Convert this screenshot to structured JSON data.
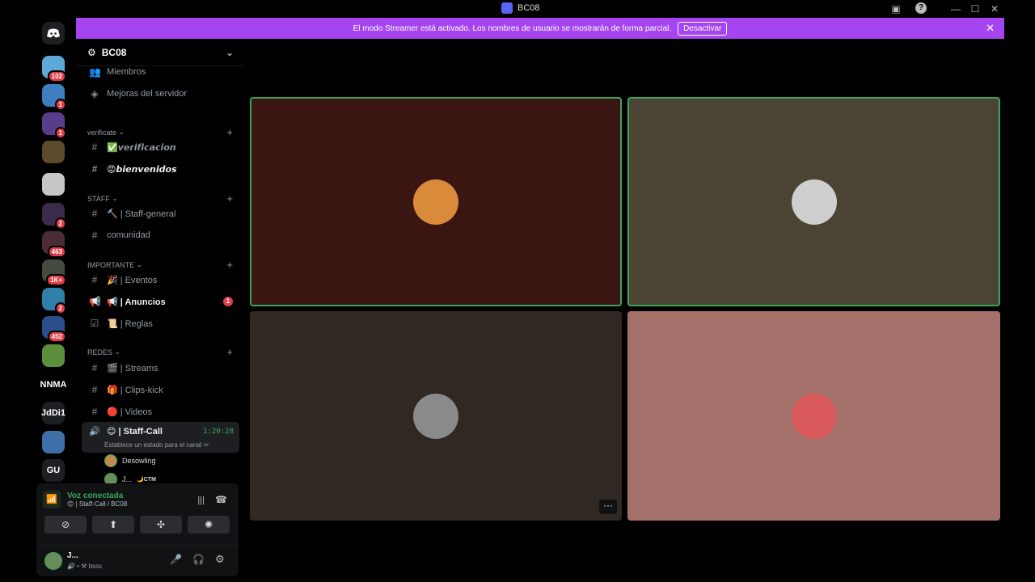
{
  "window": {
    "title": "BC08"
  },
  "servers": [
    {
      "badge": "102",
      "color": "#5ea8d8",
      "label": ""
    },
    {
      "badge": "1",
      "color": "#3d7fbf",
      "label": ""
    },
    {
      "badge": "1",
      "color": "#5a3d8a",
      "label": ""
    },
    {
      "badge": "",
      "color": "#5c4a2a",
      "label": ""
    },
    {
      "badge": "",
      "color": "#c7c7c7",
      "label": ""
    },
    {
      "badge": "2",
      "color": "#3a2b4a",
      "label": ""
    },
    {
      "badge": "463",
      "color": "#4b2b35",
      "label": ""
    },
    {
      "badge": "1K+",
      "color": "#444a40",
      "label": ""
    },
    {
      "badge": "2",
      "color": "#2f7fa8",
      "label": ""
    },
    {
      "badge": "452",
      "color": "#2b4f8a",
      "label": ""
    },
    {
      "badge": "",
      "color": "#5b8f3d",
      "label": ""
    },
    {
      "badge": "",
      "color": "#000000",
      "label": "NNMA"
    },
    {
      "badge": "",
      "color": "#1e1f22",
      "label": "JdDi1"
    },
    {
      "badge": "",
      "color": "#3e6fa8",
      "label": ""
    },
    {
      "badge": "",
      "color": "#1e1f22",
      "label": "GU"
    }
  ],
  "banner": {
    "text": "El modo Streamer está activado. Los nombres de usuario se mostrarán de forma parcial.",
    "button": "Desactivar"
  },
  "sidebar": {
    "server_name": "BC08",
    "top_items": [
      "Miembros",
      "Mejoras del servidor"
    ],
    "categories": [
      "verificate",
      "STAFF",
      "IMPORTANTE",
      "REDES"
    ],
    "channels": {
      "verificacion": "✅𝙫𝙚𝙧𝙞𝙛𝙞𝙘𝙖𝙘𝙞𝙤𝙣",
      "bienvenidos": "😡𝙗𝙞𝙚𝙣𝙫𝙚𝙣𝙞𝙙𝙤𝙨",
      "staff_general": "🔨 | Staff-general",
      "comunidad": "comunidad",
      "eventos": "🎉 | Eventos",
      "anuncios": "📢 | Anuncios",
      "anuncios_badge": "1",
      "reglas": "📜 | Reglas",
      "streams": "🎬 | Streams",
      "clips": "🎁 | Clips-kick",
      "videos": "🔴 | Videos",
      "staff_call": "😊 | Staff-Call",
      "staff_call_timer": "1:20:28",
      "staff_call_status": "Establece un estado para el canal ✏"
    },
    "voice_users": [
      {
        "name": "Desowling",
        "tag": ""
      },
      {
        "name": "J...",
        "tag": "🌙CTM"
      }
    ]
  },
  "voice_panel": {
    "status": "Voz conectada",
    "channel": "😊 | Staff-Call / BC08"
  },
  "user": {
    "name": "J...",
    "status": "🔊 • ⚒ bsss"
  },
  "tiles": [
    {
      "bg": "#3a1512",
      "border": "#3ba55d",
      "avatar": "#d98a3a"
    },
    {
      "bg": "#4b4434",
      "border": "#3ba55d",
      "avatar": "#cfcfcf"
    },
    {
      "bg": "#302823",
      "border": "",
      "avatar": "#8a8a8a"
    },
    {
      "bg": "#a4706a",
      "border": "",
      "avatar": "#d9595a"
    }
  ],
  "icons": {
    "home": "discord-icon",
    "close": "close-icon",
    "more": "more-icon"
  }
}
